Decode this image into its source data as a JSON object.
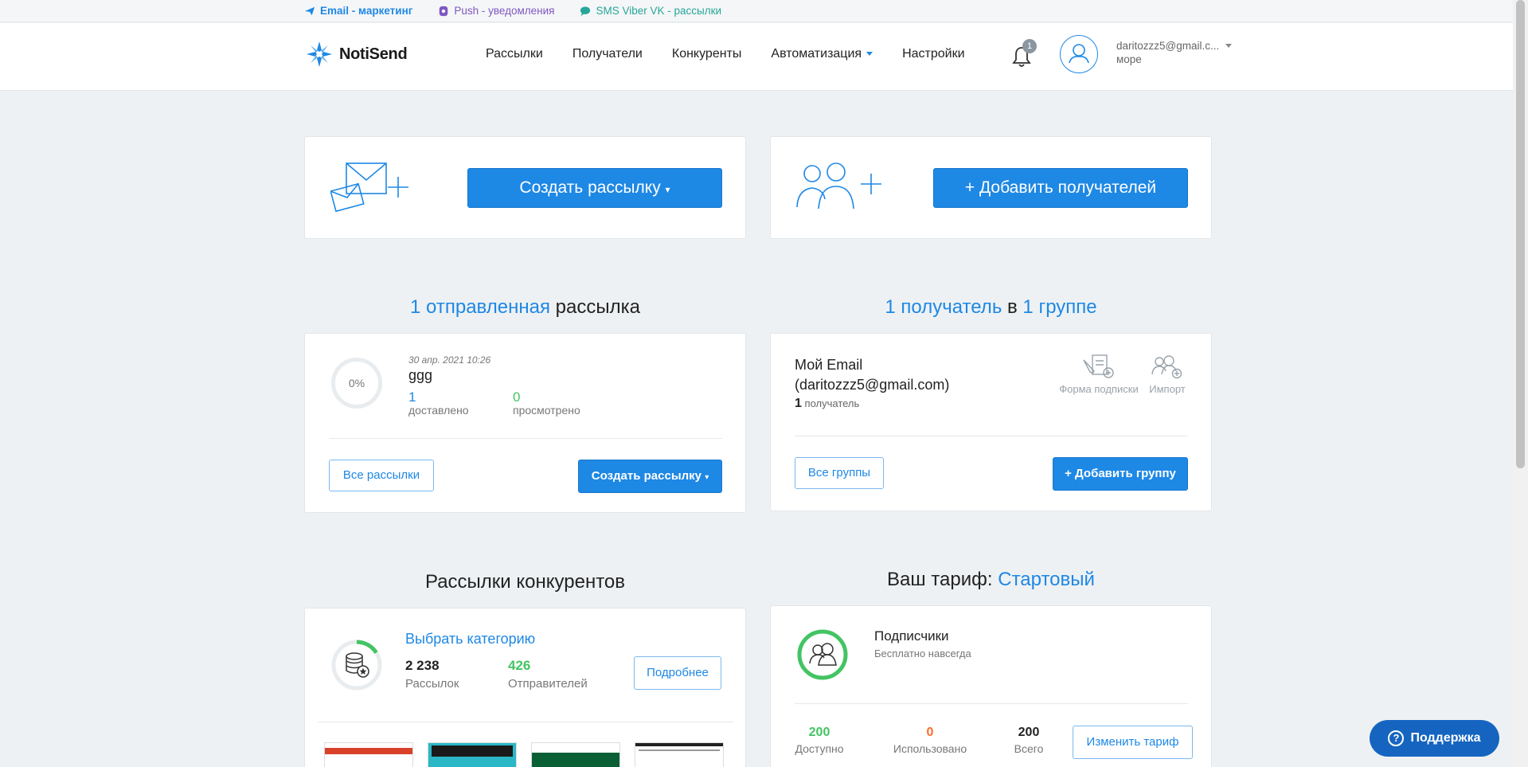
{
  "topbar": {
    "email_link": "Email - маркетинг",
    "push_link": "Push - уведомления",
    "sms_link": "SMS Viber VK - рассылки"
  },
  "header": {
    "brand": "NotiSend",
    "nav": [
      "Рассылки",
      "Получатели",
      "Конкуренты",
      "Автоматизация",
      "Настройки"
    ],
    "notifications_count": "1",
    "account_email": "daritozzz5@gmail.c...",
    "account_sub": "море"
  },
  "actions": {
    "create_campaign": "Создать рассылку",
    "add_recipients": "+ Добавить получателей"
  },
  "campaigns": {
    "title_count": "1 отправленная",
    "title_rest": "рассылка",
    "percent": "0%",
    "date": "30 апр. 2021 10:26",
    "name": "ggg",
    "delivered_value": "1",
    "delivered_label": "доставлено",
    "viewed_value": "0",
    "viewed_label": "просмотрено",
    "all_button": "Все рассылки",
    "create_button": "Создать рассылку"
  },
  "recipients": {
    "title_count": "1 получатель",
    "title_mid": "в",
    "title_group": "1 группе",
    "group_name_line1": "Мой Email",
    "group_name_line2": "(daritozzz5@gmail.com)",
    "count_value": "1",
    "count_label": "получатель",
    "form_label": "Форма подписки",
    "import_label": "Импорт",
    "all_groups_button": "Все группы",
    "add_group_button": "+ Добавить группу"
  },
  "competitors": {
    "title": "Рассылки конкурентов",
    "choose_category": "Выбрать категорию",
    "campaigns_value": "2 238",
    "campaigns_label": "Рассылок",
    "senders_value": "426",
    "senders_label": "Отправителей",
    "details_button": "Подробнее",
    "ring_fill_fraction": 0.16
  },
  "tariff": {
    "title_prefix": "Ваш тариф:",
    "title_name": "Стартовый",
    "subscribers_label": "Подписчики",
    "subscribers_sub": "Бесплатно навсегда",
    "available_value": "200",
    "available_label": "Доступно",
    "used_value": "0",
    "used_label": "Использовано",
    "total_value": "200",
    "total_label": "Всего",
    "change_button": "Изменить тариф"
  },
  "support": {
    "label": "Поддержка"
  },
  "colors": {
    "accent": "#1e88e5",
    "green": "#43c463",
    "orange": "#ff6a2b"
  }
}
